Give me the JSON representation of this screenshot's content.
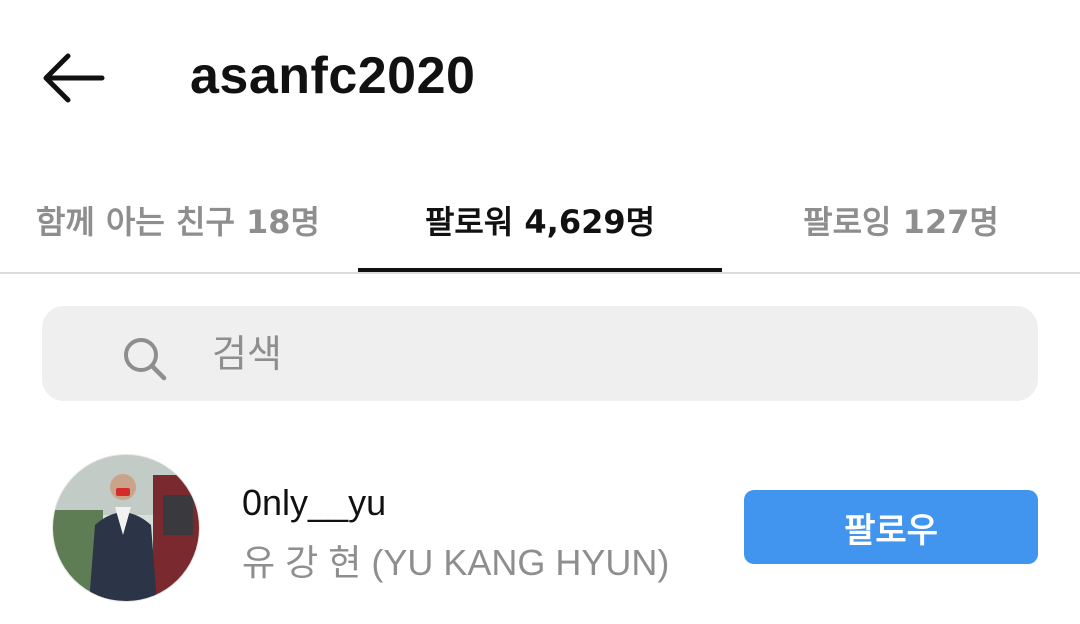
{
  "header": {
    "title": "asanfc2020",
    "back_icon": "arrow-left-icon"
  },
  "tabs": [
    {
      "label": "함께 아는 친구 18명",
      "active": false
    },
    {
      "label": "팔로워 4,629명",
      "active": true
    },
    {
      "label": "팔로잉 127명",
      "active": false
    }
  ],
  "search": {
    "placeholder": "검색",
    "icon": "search-icon"
  },
  "list": [
    {
      "username": "0nly__yu",
      "full_name": "유 강 현 (YU KANG HYUN)",
      "button_label": "팔로우",
      "button_color": "#4295ef"
    }
  ],
  "colors": {
    "accent": "#4295ef",
    "muted_text": "#8e8e8e",
    "search_bg": "#efefef"
  }
}
